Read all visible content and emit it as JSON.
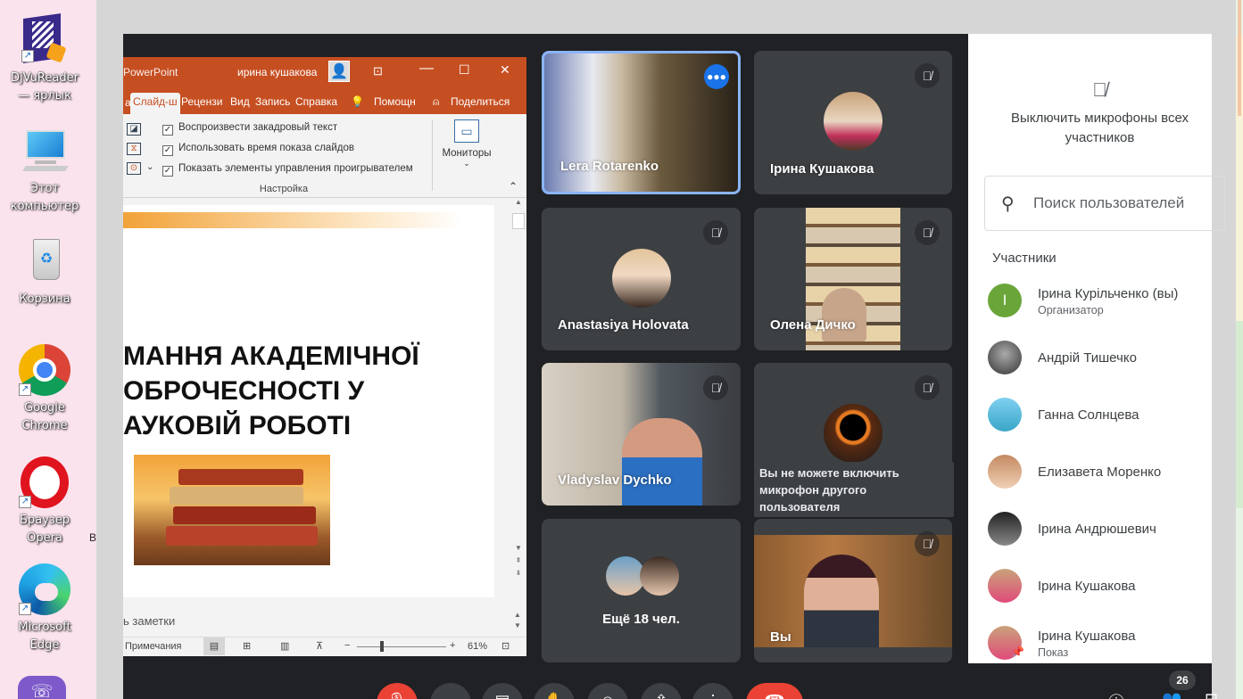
{
  "desktop": {
    "icons": [
      {
        "label": "DjVuReader\n— ярлык",
        "icon": "djvu-reader-icon"
      },
      {
        "label": "Этот\nкомпьютер",
        "icon": "computer-icon"
      },
      {
        "label": "Корзина",
        "icon": "recycle-bin-icon"
      },
      {
        "label": "Google\nChrome",
        "icon": "chrome-icon"
      },
      {
        "label": "Браузер\nOpera",
        "icon": "opera-icon"
      },
      {
        "label": "Microsoft\nEdge",
        "icon": "edge-icon"
      }
    ],
    "stray": {
      "b": "B",
      "a": "a",
      "i": "i"
    }
  },
  "powerpoint": {
    "app": "PowerPoint",
    "user": "ирина кушакова",
    "tabs": [
      "Слайд-ш",
      "Рецензи",
      "Вид",
      "Запись",
      "Справка",
      "Помощн",
      "Поделиться"
    ],
    "options": [
      "Воспроизвести закадровый текст",
      "Использовать время показа слайдов",
      "Показать элементы управления проигрывателем"
    ],
    "group_label": "Настройка",
    "monitors_label": "Мониторы",
    "slide_title": "МАННЯ АКАДЕМІЧНОЇ\nОБРОЧЕСНОСТІ У\nАУКОВІЙ РОБОТІ",
    "notes_placeholder": "ь заметки",
    "status_notes": "Примечания",
    "zoom": "61%"
  },
  "meet": {
    "tiles": [
      {
        "name": "Lera Rotarenko",
        "speaking": true
      },
      {
        "name": "Ірина Кушакова",
        "muted": true
      },
      {
        "name": "Anastasiya Holovata",
        "muted": true
      },
      {
        "name": "Олена Дичко",
        "muted": true
      },
      {
        "name": "Vladyslav Dychko",
        "muted": true
      },
      {
        "tooltip": "Вы не можете включить микрофон другого пользователя",
        "muted": true
      },
      {
        "more": "Ещё 18 чел."
      },
      {
        "name": "Вы",
        "muted": true
      }
    ],
    "controls_badge": "26"
  },
  "panel": {
    "mute_all": "Выключить микрофоны всех участников",
    "search_placeholder": "Поиск пользователей",
    "section": "Участники",
    "participants": [
      {
        "name": "Ірина Курільченко (вы)",
        "sub": "Организатор",
        "initial": "I",
        "color": "#6aa53a"
      },
      {
        "name": "Андрій Тишечко"
      },
      {
        "name": "Ганна Солнцева"
      },
      {
        "name": "Елизавета Моренко"
      },
      {
        "name": "Ірина Андрюшевич"
      },
      {
        "name": "Ірина Кушакова"
      },
      {
        "name": "Ірина Кушакова",
        "sub": "Показ"
      }
    ]
  },
  "colors": {
    "meet_bg": "#202124",
    "tile": "#3c4043",
    "ppt_accent": "#c64f22",
    "active_border": "#8ab4f8",
    "end_call": "#ea4335"
  }
}
